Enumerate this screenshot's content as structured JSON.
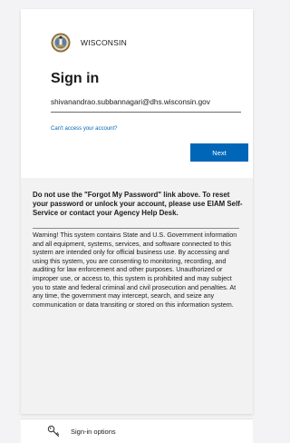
{
  "brand": {
    "name": "WISCONSIN",
    "icon": "wisconsin-seal-icon"
  },
  "signin": {
    "title": "Sign in",
    "email": "shivanandrao.subbannagari@dhs.wisconsin.gov",
    "cant_access": "Can't access your account?",
    "next": "Next"
  },
  "notice": "Do not use the \"Forgot My Password\" link above. To reset your password or unlock your account, please use EIAM Self-Service or contact your Agency Help Desk.",
  "warning": "Warning! This system contains State and U.S. Government information and all equipment, systems, services, and software connected to this system are intended only for official business use. By accessing and using this system, you are consenting to monitoring, recording, and auditing for law enforcement and other purposes. Unauthorized or improper use, or access to, this system is prohibited and may subject you to state and federal criminal and civil prosecution and penalties. At any time, the government may intercept, search, and seize any communication or data transiting or stored on this information system.",
  "signin_options": {
    "label": "Sign-in options",
    "icon": "key-icon"
  },
  "colors": {
    "accent": "#0067b8",
    "lower_panel": "#f2f2f2",
    "page_bg": "#f3f3f5"
  }
}
